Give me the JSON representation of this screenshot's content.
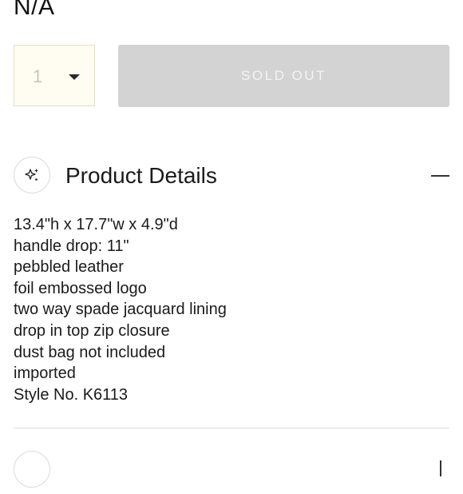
{
  "price": "N/A",
  "quantity": {
    "value": "1",
    "icon": "chevron-down-icon"
  },
  "purchase": {
    "button_label": "SOLD OUT"
  },
  "product_details": {
    "icon": "sparkle-icon",
    "title": "Product Details",
    "toggle_icon": "collapse-icon",
    "items": [
      "13.4\"h x 17.7\"w x 4.9\"d",
      "handle drop: 11\"",
      "pebbled leather",
      "foil embossed logo",
      "two way spade jacquard lining",
      "drop in top zip closure",
      "dust bag not included",
      "imported",
      "Style No. K6113"
    ]
  }
}
